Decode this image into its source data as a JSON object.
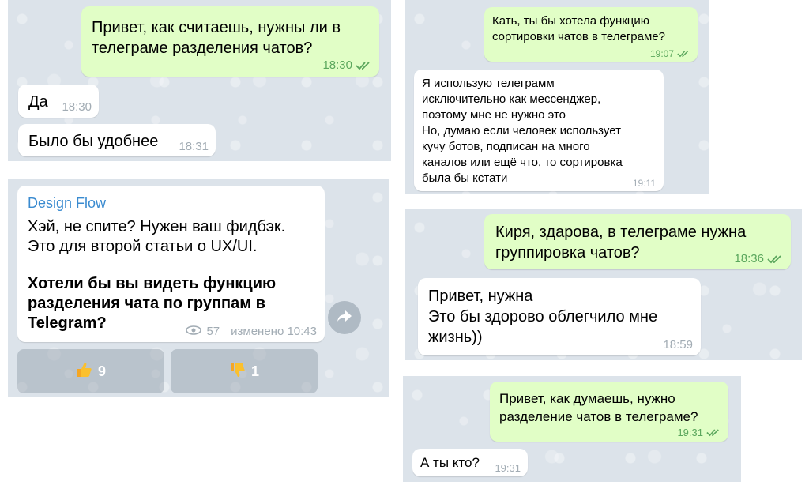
{
  "panels": {
    "p1": {
      "m1": {
        "text": "Привет, как считаешь, нужны ли в\nтелеграме разделения чатов?",
        "time": "18:30"
      },
      "m2": {
        "text": "Да",
        "time": "18:30"
      },
      "m3": {
        "text": "Было бы удобнее",
        "time": "18:31"
      }
    },
    "p2": {
      "m1": {
        "text": "Кать, ты бы хотела функцию\nсортировки чатов в телеграме?",
        "time": "19:07"
      },
      "m2": {
        "text": "Я использую телеграмм\nисключительно как мессенджер,\nпоэтому мне не нужно это\nНо, думаю если человек использует\nкучу ботов, подписан на много\nканалов или ещё что, то сортировка\nбыла бы кстати",
        "time": "19:11"
      }
    },
    "p3": {
      "channel": "Design Flow",
      "body": "Хэй, не спите? Нужен ваш фидбэк.\nЭто для второй статьи о UX/UI.",
      "question": "Хотели бы вы видеть функцию\nразделения чата по группам в\nTelegram?",
      "views": "57",
      "edited": "изменено 10:43",
      "like_count": "9",
      "dislike_count": "1",
      "icons": {
        "views": "eye-icon",
        "share": "share-arrow-icon",
        "like": "thumbs-up-icon",
        "dislike": "thumbs-down-icon"
      }
    },
    "p4": {
      "m1": {
        "text": "Киря, здарова, в телеграме нужна\nгруппировка чатов?",
        "time": "18:36"
      },
      "m2": {
        "text": "Привет, нужна\nЭто бы здорово облегчило мне\nжизнь))",
        "time": "18:59"
      }
    },
    "p5": {
      "m1": {
        "text": "Привет, как думаешь, нужно\nразделение чатов в телеграме?",
        "time": "19:31"
      },
      "m2": {
        "text": "А ты кто?",
        "time": "19:31"
      }
    }
  },
  "colors": {
    "incoming": "#ffffff",
    "outgoing": "#e1fec6",
    "background": "#dce3ea",
    "channel_accent": "#3a8bd0",
    "check": "#5ba75d"
  }
}
